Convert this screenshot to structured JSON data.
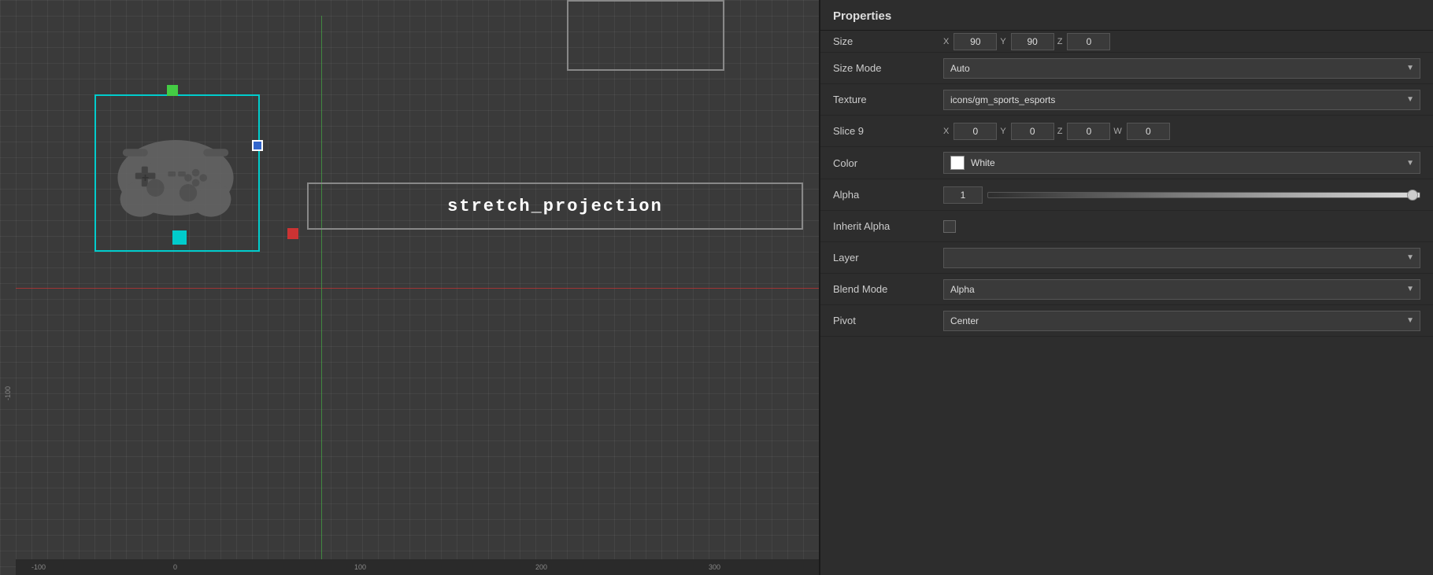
{
  "panel": {
    "title": "Properties",
    "size": {
      "label": "Size",
      "x_label": "X",
      "x_value": "90",
      "y_label": "Y",
      "y_value": "90",
      "z_label": "Z",
      "z_value": "0"
    },
    "size_mode": {
      "label": "Size Mode",
      "value": "Auto",
      "chevron": "▼"
    },
    "texture": {
      "label": "Texture",
      "value": "icons/gm_sports_esports",
      "chevron": "▼"
    },
    "slice9": {
      "label": "Slice 9",
      "x_label": "X",
      "x_value": "0",
      "y_label": "Y",
      "y_value": "0",
      "z_label": "Z",
      "z_value": "0",
      "w_label": "W",
      "w_value": "0"
    },
    "color": {
      "label": "Color",
      "value": "White",
      "swatch_color": "#ffffff",
      "chevron": "▼"
    },
    "alpha": {
      "label": "Alpha",
      "value": "1"
    },
    "inherit_alpha": {
      "label": "Inherit Alpha"
    },
    "layer": {
      "label": "Layer",
      "value": "",
      "chevron": "▼"
    },
    "blend_mode": {
      "label": "Blend Mode",
      "value": "Alpha",
      "chevron": "▼"
    },
    "pivot": {
      "label": "Pivot",
      "value": "Center",
      "chevron": "▼"
    }
  },
  "canvas": {
    "stretch_text": "stretch_projection",
    "ruler_numbers_bottom": [
      "-100",
      "0",
      "100",
      "200",
      "300"
    ],
    "ruler_numbers_left": [
      "-100"
    ]
  }
}
